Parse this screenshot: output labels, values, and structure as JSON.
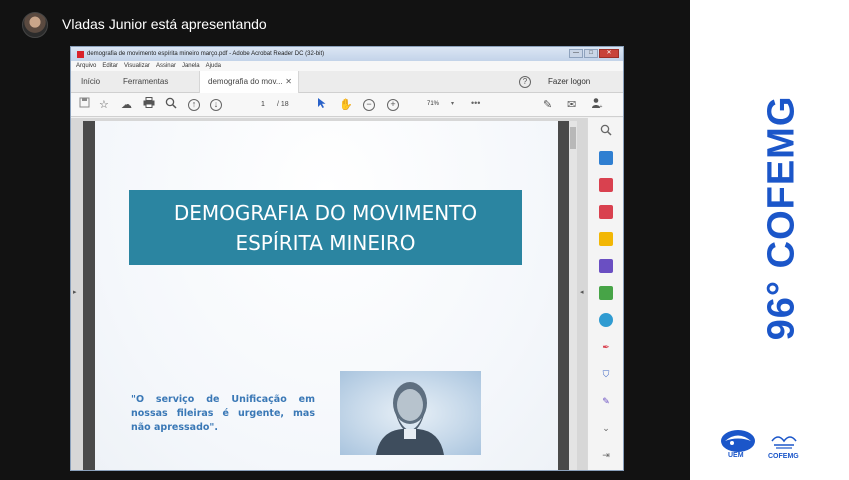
{
  "meeting": {
    "presenter_text": "Vladas Junior está apresentando"
  },
  "window": {
    "title": "demografia de movimento espírita mineiro março.pdf - Adobe Acrobat Reader DC (32-bit)",
    "controls": [
      "—",
      "□",
      "✕"
    ]
  },
  "menubar": [
    "Arquivo",
    "Editar",
    "Visualizar",
    "Assinar",
    "Janela",
    "Ajuda"
  ],
  "tabs": {
    "home": "Início",
    "tools": "Ferramentas",
    "document": "demografia do mov...",
    "close_symbol": "✕",
    "login": "Fazer logon"
  },
  "toolbar": {
    "page_current": "1",
    "page_total": "/ 18",
    "zoom": "71%",
    "zoom_caret": "▾",
    "more": "•••"
  },
  "slide": {
    "title_line1": "DEMOGRAFIA DO MOVIMENTO",
    "title_line2": "ESPÍRITA MINEIRO",
    "quote": "\"O serviço de Unificação em nossas fileiras é urgente, mas não apressado\"."
  },
  "branding": {
    "title": "96° COFEMG",
    "logo1_text": "UEM",
    "logo2_text": "COFEMG",
    "color": "#1b56c9"
  },
  "colors": {
    "banner": "#2b85a1",
    "quote": "#3a78b6",
    "meeting_bg": "#121212"
  },
  "tool_panel_icons": [
    {
      "name": "zoom-tool-icon",
      "color": "#666666"
    },
    {
      "name": "create-pdf-icon",
      "color": "#2f7fd1"
    },
    {
      "name": "organize-pages-icon",
      "color": "#d9414f"
    },
    {
      "name": "export-pdf-icon",
      "color": "#d9414f"
    },
    {
      "name": "comment-icon",
      "color": "#f2b705"
    },
    {
      "name": "fill-sign-icon",
      "color": "#6a4fc2"
    },
    {
      "name": "edit-pdf-icon",
      "color": "#47a447"
    },
    {
      "name": "scan-icon",
      "color": "#2f9bd1"
    },
    {
      "name": "sign-icon",
      "color": "#d9414f"
    },
    {
      "name": "protect-icon",
      "color": "#3a63c4"
    },
    {
      "name": "pen-icon",
      "color": "#6a4fc2"
    },
    {
      "name": "chevron-down-icon",
      "color": "#666666"
    },
    {
      "name": "expand-panel-icon",
      "color": "#666666"
    }
  ]
}
